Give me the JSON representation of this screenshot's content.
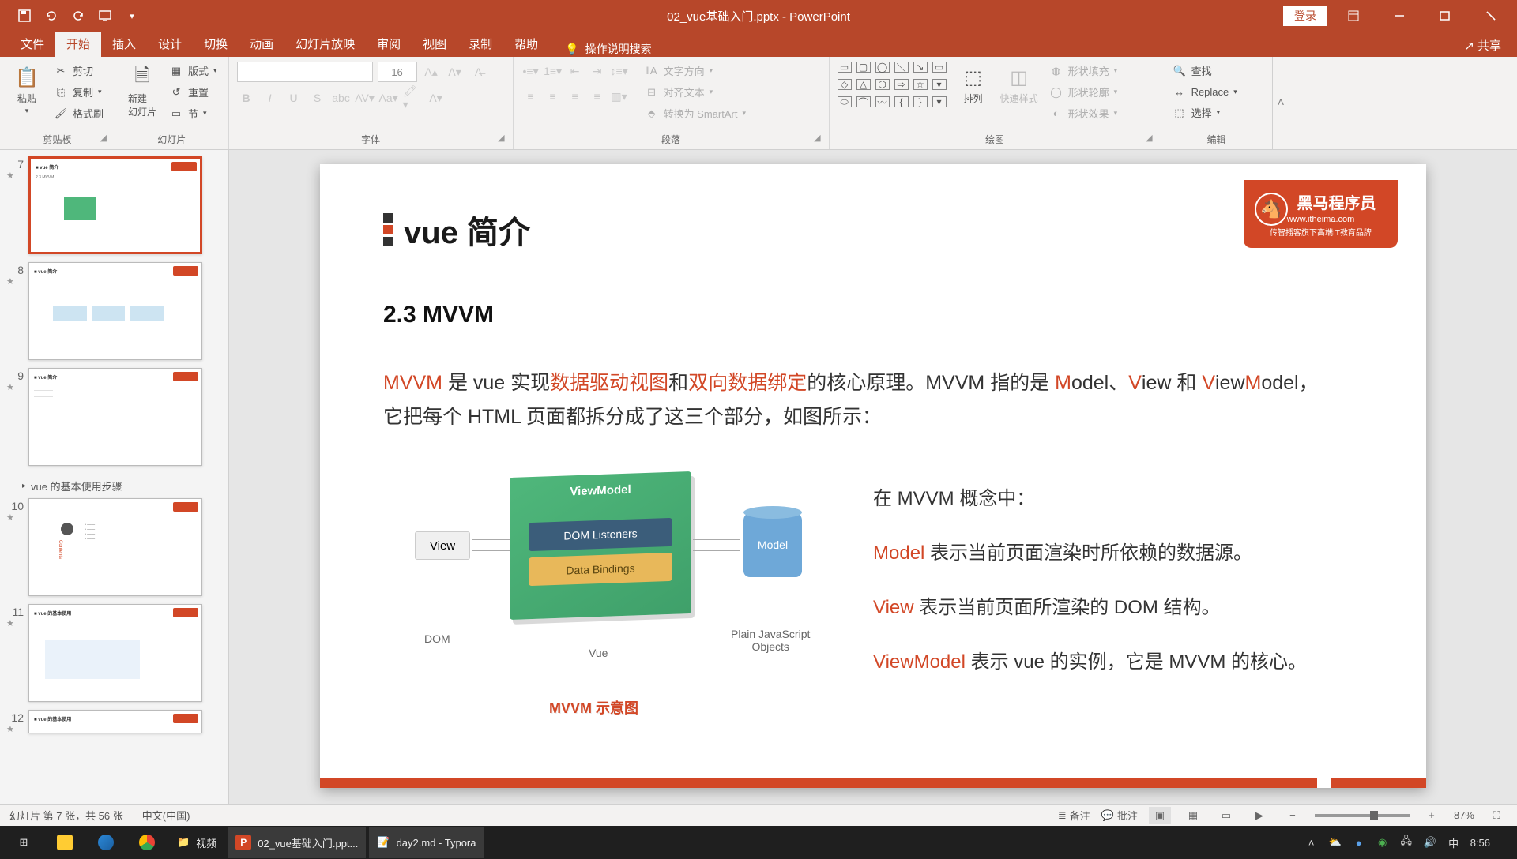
{
  "titleBar": {
    "docTitle": "02_vue基础入门.pptx - PowerPoint",
    "login": "登录"
  },
  "tabs": {
    "file": "文件",
    "home": "开始",
    "insert": "插入",
    "design": "设计",
    "transitions": "切换",
    "animations": "动画",
    "slideshow": "幻灯片放映",
    "review": "审阅",
    "view": "视图",
    "recording": "录制",
    "help": "帮助",
    "tellMe": "操作说明搜索",
    "share": "共享"
  },
  "ribbon": {
    "clipboard": {
      "label": "剪贴板",
      "paste": "粘贴",
      "cut": "剪切",
      "copy": "复制",
      "formatPainter": "格式刷"
    },
    "slides": {
      "label": "幻灯片",
      "newSlide": "新建\n幻灯片",
      "layout": "版式",
      "reset": "重置",
      "section": "节"
    },
    "font": {
      "label": "字体",
      "size": "16"
    },
    "paragraph": {
      "label": "段落",
      "textDir": "文字方向",
      "align": "对齐文本",
      "smartart": "转换为 SmartArt"
    },
    "drawing": {
      "label": "绘图",
      "arrange": "排列",
      "quickStyles": "快速样式",
      "fill": "形状填充",
      "outline": "形状轮廓",
      "effects": "形状效果"
    },
    "editing": {
      "label": "编辑",
      "find": "查找",
      "replace": "Replace",
      "select": "选择"
    }
  },
  "thumbs": {
    "section": "vue 的基本使用步骤",
    "n7": "7",
    "n8": "8",
    "n9": "9",
    "n10": "10",
    "n11": "11",
    "n12": "12"
  },
  "slide": {
    "title": "vue 简介",
    "subtitle": "2.3 MVVM",
    "logoMain": "黑马程序员",
    "logoUrl": "www.itheima.com",
    "logoTag": "传智播客旗下高端IT教育品牌",
    "p1_a": "MVVM",
    "p1_b": " 是 vue 实现",
    "p1_c": "数据驱动视图",
    "p1_d": "和",
    "p1_e": "双向数据绑定",
    "p1_f": "的核心原理。MVVM 指的是 ",
    "p1_g": "M",
    "p1_h": "odel、",
    "p1_i": "V",
    "p1_j": "iew 和 ",
    "p1_k": "V",
    "p1_l": "iew",
    "p1_m": "M",
    "p1_n": "odel，",
    "p2": "它把每个 HTML 页面都拆分成了这三个部分，如图所示：",
    "diagram": {
      "vm": "ViewModel",
      "dl": "DOM Listeners",
      "db": "Data Bindings",
      "view": "View",
      "model": "Model",
      "dom": "DOM",
      "vue": "Vue",
      "pjo": "Plain JavaScript\nObjects",
      "caption": "MVVM 示意图"
    },
    "concept_intro": "在 MVVM 概念中：",
    "c1a": "Model",
    "c1b": " 表示当前页面渲染时所依赖的数据源。",
    "c2a": "View",
    "c2b": "  表示当前页面所渲染的 DOM 结构。",
    "c3a": "ViewModel",
    "c3b": " 表示 vue 的实例，它是 MVVM 的核心。"
  },
  "status": {
    "slideInfo": "幻灯片 第 7 张，共 56 张",
    "lang": "中文(中国)",
    "notes": "备注",
    "comments": "批注",
    "zoom": "87%"
  },
  "taskbar": {
    "folder": "视频",
    "ppt": "02_vue基础入门.ppt...",
    "typora": "day2.md - Typora",
    "ime": "中",
    "time": "8:56"
  }
}
